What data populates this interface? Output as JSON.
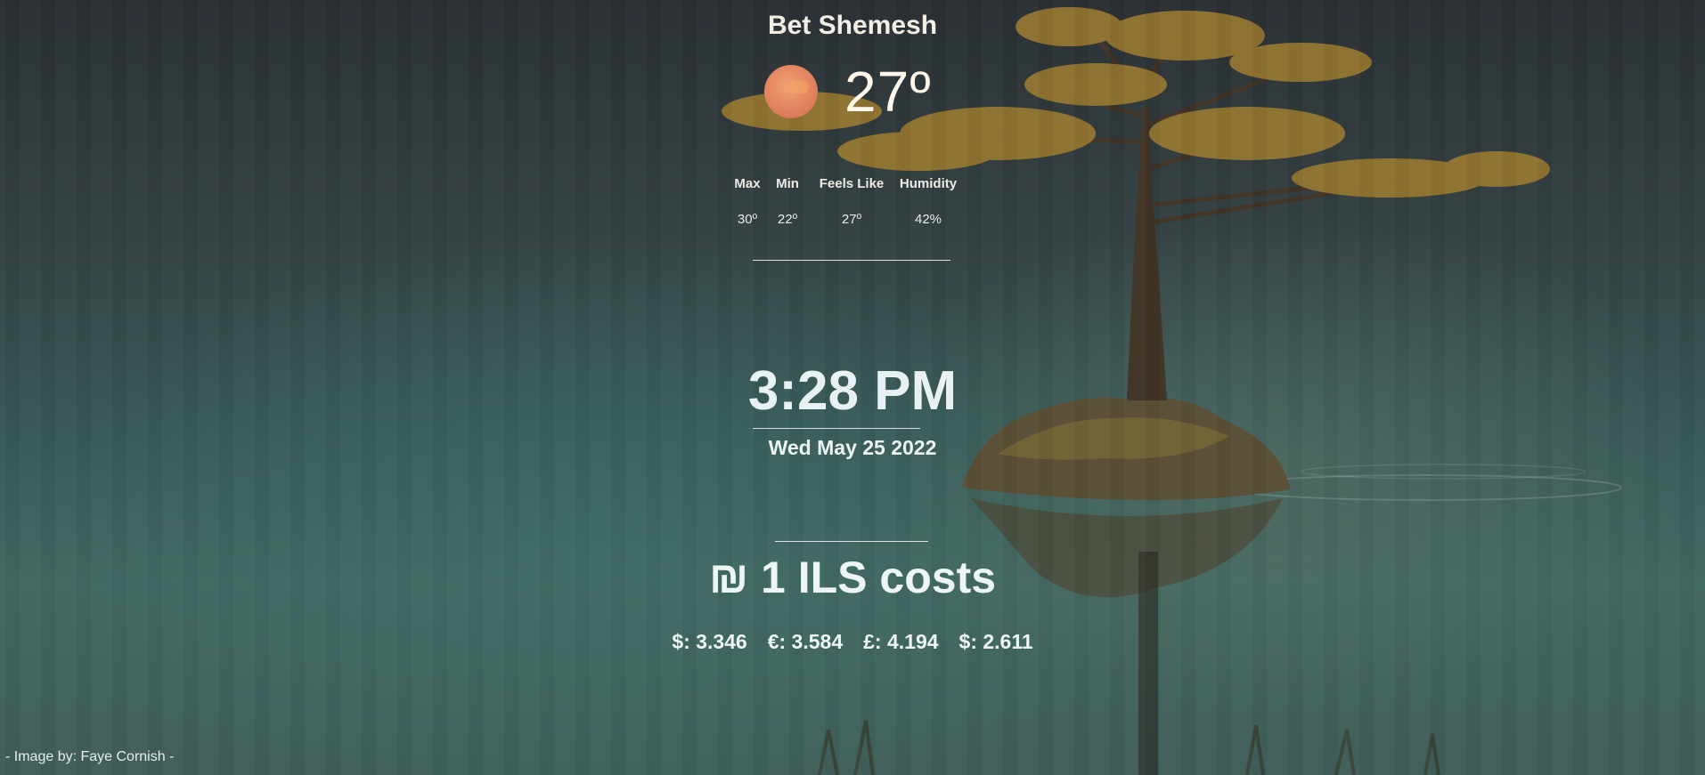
{
  "weather": {
    "city": "Bet Shemesh",
    "icon": "sun-icon",
    "temperature": "27º",
    "stats": {
      "max_label": "Max",
      "max_value": "30º",
      "min_label": "Min",
      "min_value": "22º",
      "feels_label": "Feels Like",
      "feels_value": "27º",
      "humidity_label": "Humidity",
      "humidity_value": "42%"
    }
  },
  "clock": {
    "time": "3:28 PM",
    "date": "Wed May 25 2022"
  },
  "currency": {
    "headline": "₪ 1 ILS costs",
    "rates": [
      "$: 3.346",
      "€: 3.584",
      "£: 4.194",
      "$: 2.611"
    ]
  },
  "background": {
    "credit": "- Image by: Faye Cornish -"
  }
}
